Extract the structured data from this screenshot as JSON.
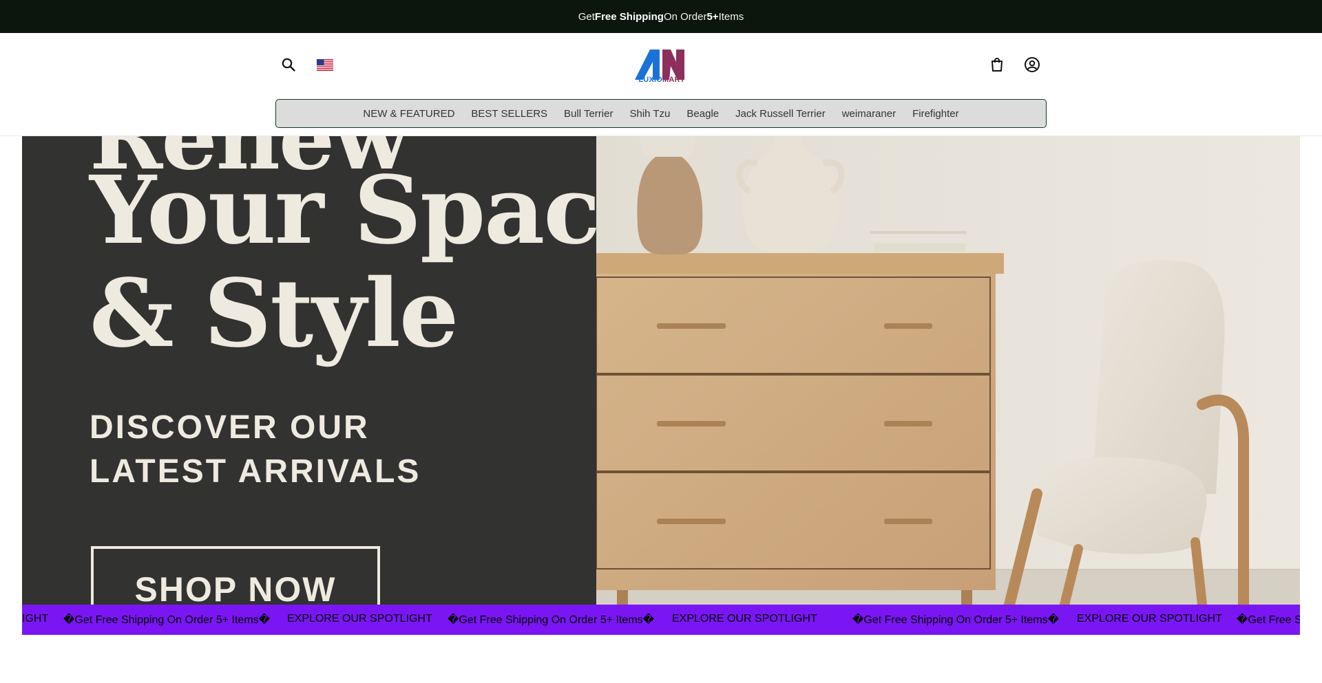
{
  "announcement": {
    "prefix_glyph": "",
    "get": "Get ",
    "free_shipping": "Free Shipping",
    "on_order": " On Order ",
    "count": "5+",
    "items": " Items",
    "suffix_glyph": ""
  },
  "header": {
    "logo": {
      "part1": "LUXIO",
      "part2": "MART",
      "color_blue": "#1a72d9",
      "color_plum": "#8c2f5a"
    },
    "icons": {
      "search": "search-icon",
      "flag": "us-flag-icon",
      "cart": "shopping-bag-icon",
      "account": "user-circle-icon"
    }
  },
  "nav": {
    "items": [
      "NEW & FEATURED",
      "BEST SELLERS",
      "Bull Terrier",
      "Shih Tzu",
      "Beagle",
      "Jack Russell Terrier",
      "weimaraner",
      "Firefighter"
    ]
  },
  "hero": {
    "headline_line0": "Renew",
    "headline_line1": "Your Space",
    "headline_line2": "& Style",
    "subheadline": "DISCOVER OUR LATEST ARRIVALS",
    "cta": "SHOP NOW",
    "bg_dark": "#323230",
    "text_color": "#efeae0"
  },
  "marquee": {
    "bg": "#7a16f3",
    "items": [
      "IGHT",
      "Get Free Shipping On Order 5+ Items",
      "EXPLORE OUR SPOTLIGHT",
      "Get Free Shipping On Order 5+ Items",
      "EXPLORE OUR SPOTLIGHT",
      "Get Free Shipping On Order 5+ Items",
      "EXPLORE OUR SPOTLIGHT",
      "Get Free Sh"
    ]
  }
}
